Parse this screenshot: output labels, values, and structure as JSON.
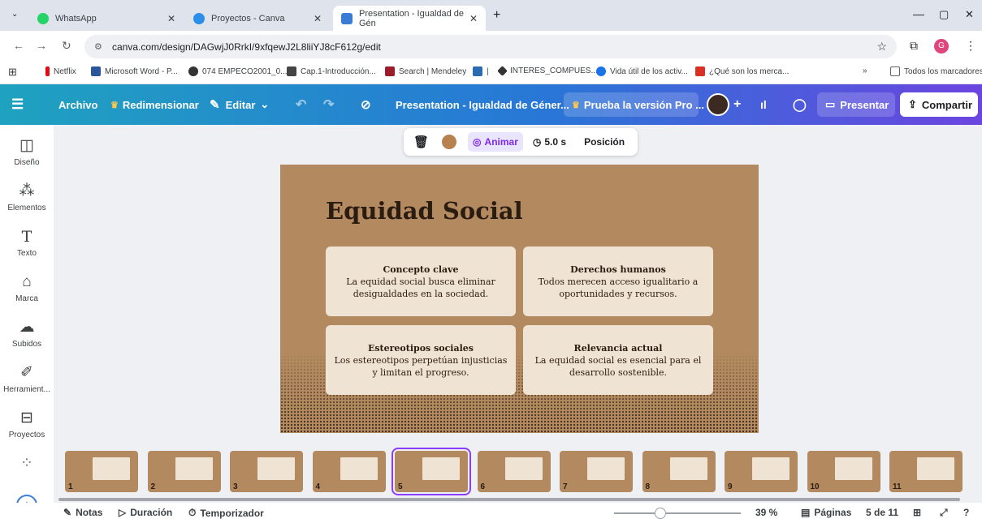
{
  "tabs": [
    {
      "title": "WhatsApp",
      "color": "#25d366"
    },
    {
      "title": "Proyectos - Canva",
      "color": "#2b8ee8"
    },
    {
      "title": "Presentation - Igualdad de Gén",
      "color": "#3a7bd5"
    }
  ],
  "address": {
    "url": "canva.com/design/DAGwjJ0RrkI/9xfqewJ2L8liiYJ8cF612g/edit"
  },
  "bookmarks": [
    "Netflix",
    "Microsoft Word - P...",
    "074 EMPECO2001_0...",
    "Cap.1-Introducción...",
    "Search | Mendeley",
    "|",
    "INTERES_COMPUES...",
    "Vida útil de los activ...",
    "¿Qué son los merca...",
    "Todos los marcadores"
  ],
  "toolbar": {
    "archivo": "Archivo",
    "redimensionar": "Redimensionar",
    "editar": "Editar",
    "doc_title": "Presentation - Igualdad de Géner...",
    "pro": "Prueba la versión Pro ...",
    "presentar": "Presentar",
    "compartir": "Compartir"
  },
  "sidebar": [
    "Diseño",
    "Elementos",
    "Texto",
    "Marca",
    "Subidos",
    "Herramient...",
    "Proyectos"
  ],
  "context_toolbar": {
    "animar": "Animar",
    "duration": "5.0 s",
    "posicion": "Posición",
    "color": "#b7814f"
  },
  "slide": {
    "title": "Equidad Social",
    "cards": [
      {
        "heading": "Concepto clave",
        "body": "La equidad social busca eliminar desigualdades en la sociedad."
      },
      {
        "heading": "Derechos humanos",
        "body": "Todos merecen acceso igualitario a oportunidades y recursos."
      },
      {
        "heading": "Estereotipos sociales",
        "body": "Los estereotipos perpetúan injusticias y limitan el progreso."
      },
      {
        "heading": "Relevancia actual",
        "body": "La equidad social es esencial para el desarrollo sostenible."
      }
    ]
  },
  "thumbnails": [
    "1",
    "2",
    "3",
    "4",
    "5",
    "6",
    "7",
    "8",
    "9",
    "10",
    "11"
  ],
  "bottom": {
    "notas": "Notas",
    "duracion": "Duración",
    "temporizador": "Temporizador",
    "zoom": "39 %",
    "paginas": "Páginas",
    "page_count": "5 de 11"
  }
}
